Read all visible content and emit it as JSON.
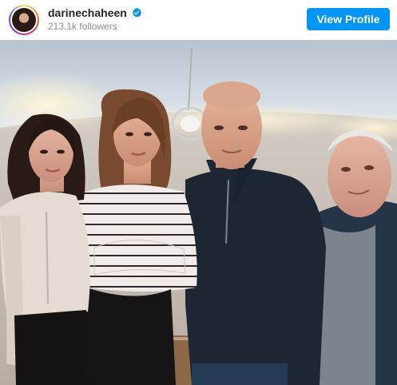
{
  "profile": {
    "username": "darinechaheen",
    "followers": "213.1k followers",
    "verified": true
  },
  "actions": {
    "view_profile_label": "View Profile"
  },
  "post": {
    "image": "group-photo"
  },
  "colors": {
    "brand_blue": "#0095f6",
    "text_dark": "#262626",
    "text_muted": "#8e8e8e"
  },
  "icons": [
    "verified-badge-icon"
  ]
}
